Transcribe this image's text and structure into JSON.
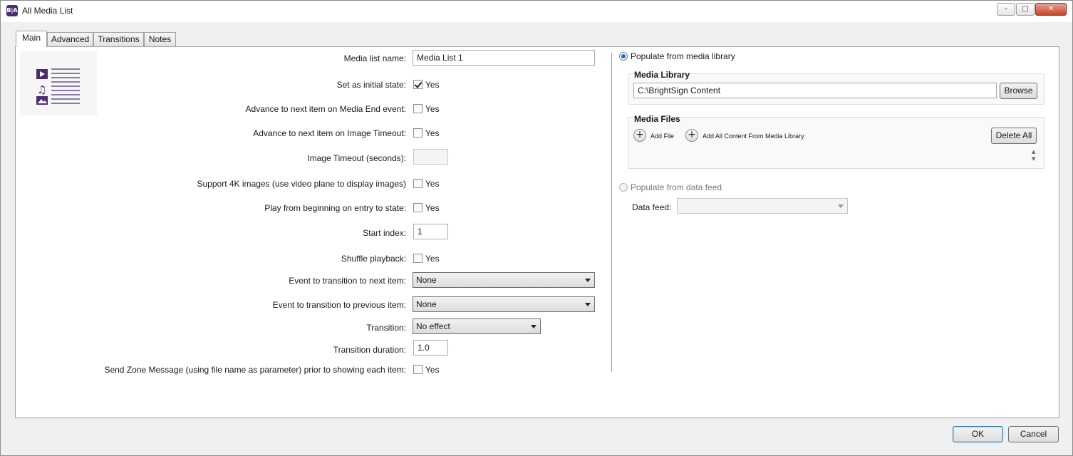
{
  "window": {
    "title": "All Media List",
    "app_icon_text": "B|A",
    "minimize": "–",
    "maximize": "□",
    "close": "✕"
  },
  "tabs": [
    {
      "label": "Main",
      "active": true
    },
    {
      "label": "Advanced",
      "active": false
    },
    {
      "label": "Transitions",
      "active": false
    },
    {
      "label": "Notes",
      "active": false
    }
  ],
  "form": {
    "media_list_name": {
      "label": "Media list name:",
      "value": "Media List 1"
    },
    "initial_state": {
      "label": "Set as initial state:",
      "checked": true,
      "option": "Yes"
    },
    "advance_media_end": {
      "label": "Advance to next item on Media End event:",
      "checked": false,
      "option": "Yes"
    },
    "advance_image_timeout": {
      "label": "Advance to next item on Image Timeout:",
      "checked": false,
      "option": "Yes"
    },
    "image_timeout": {
      "label": "Image Timeout (seconds):",
      "value": ""
    },
    "support_4k": {
      "label": "Support 4K images (use video plane to display images)",
      "checked": false,
      "option": "Yes"
    },
    "play_from_beginning": {
      "label": "Play from beginning on entry to state:",
      "checked": false,
      "option": "Yes"
    },
    "start_index": {
      "label": "Start index:",
      "value": "1"
    },
    "shuffle": {
      "label": "Shuffle playback:",
      "checked": false,
      "option": "Yes"
    },
    "next_event": {
      "label": "Event to transition to next item:",
      "value": "None"
    },
    "prev_event": {
      "label": "Event to transition to previous item:",
      "value": "None"
    },
    "transition": {
      "label": "Transition:",
      "value": "No effect"
    },
    "transition_duration": {
      "label": "Transition duration:",
      "value": "1.0"
    },
    "send_zone_message": {
      "label": "Send Zone Message (using file name as parameter) prior to showing each item:",
      "checked": false,
      "option": "Yes"
    }
  },
  "right": {
    "populate_library": {
      "label": "Populate from media library",
      "selected": true
    },
    "media_library": {
      "title": "Media Library",
      "path": "C:\\BrightSign Content",
      "browse": "Browse"
    },
    "media_files": {
      "title": "Media Files",
      "add_file": "Add File",
      "add_all": "Add All Content From Media Library",
      "delete_all": "Delete All"
    },
    "populate_feed": {
      "label": "Populate from data feed",
      "selected": false
    },
    "data_feed": {
      "label": "Data feed:",
      "value": ""
    }
  },
  "footer": {
    "ok": "OK",
    "cancel": "Cancel"
  },
  "colors": {
    "accent": "#1e6bd6",
    "icon_purple": "#4a2d6e"
  }
}
